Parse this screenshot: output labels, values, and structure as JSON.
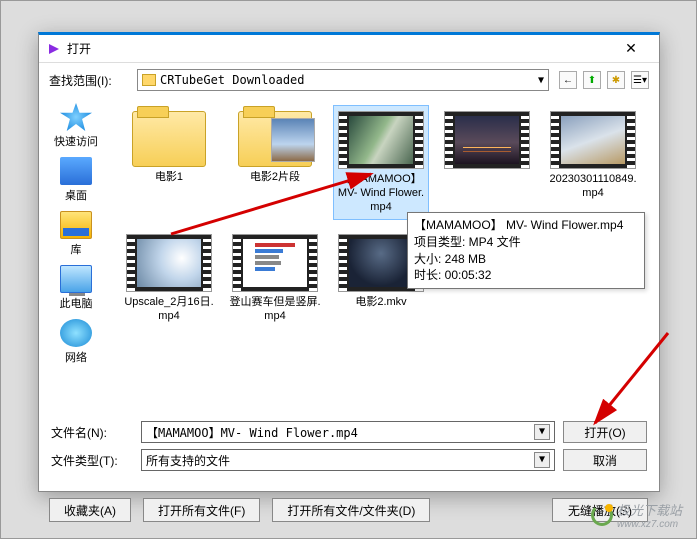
{
  "dialog": {
    "title": "打开",
    "close_x_label": "✕",
    "look_in_label": "查找范围(I):",
    "location": "CRTubeGet Downloaded"
  },
  "sidebar": {
    "items": [
      {
        "label": "快速访问"
      },
      {
        "label": "桌面"
      },
      {
        "label": "库"
      },
      {
        "label": "此电脑"
      },
      {
        "label": "网络"
      }
    ]
  },
  "files": [
    {
      "name": "电影1",
      "type": "folder"
    },
    {
      "name": "电影2片段",
      "type": "folder"
    },
    {
      "name": "【MAMAMOO】 MV- Wind Flower.mp4",
      "type": "video",
      "selected": true
    },
    {
      "name": "",
      "type": "video"
    },
    {
      "name": "20230301110849.mp4",
      "type": "video"
    },
    {
      "name": "Upscale_2月16日.mp4",
      "type": "video"
    },
    {
      "name": "登山赛车但是竖屏.mp4",
      "type": "video"
    },
    {
      "name": "电影2.mkv",
      "type": "video"
    }
  ],
  "tooltip": {
    "line1": "【MAMAMOO】 MV- Wind Flower.mp4",
    "line2_label": "项目类型: ",
    "line2_value": "MP4 文件",
    "line3_label": "大小: ",
    "line3_value": "248 MB",
    "line4_label": "时长: ",
    "line4_value": "00:05:32"
  },
  "fields": {
    "filename_label": "文件名(N):",
    "filename_value": "【MAMAMOO】MV- Wind Flower.mp4",
    "filetype_label": "文件类型(T):",
    "filetype_value": "所有支持的文件"
  },
  "buttons": {
    "open": "打开(O)",
    "cancel": "取消",
    "favorites": "收藏夹(A)",
    "open_all_files": "打开所有文件(F)",
    "open_all_folders": "打开所有文件/文件夹(D)",
    "seamless": "无缝播放(S)"
  },
  "watermark": {
    "text1": "极光下载站",
    "text2": "www.xz7.com"
  }
}
